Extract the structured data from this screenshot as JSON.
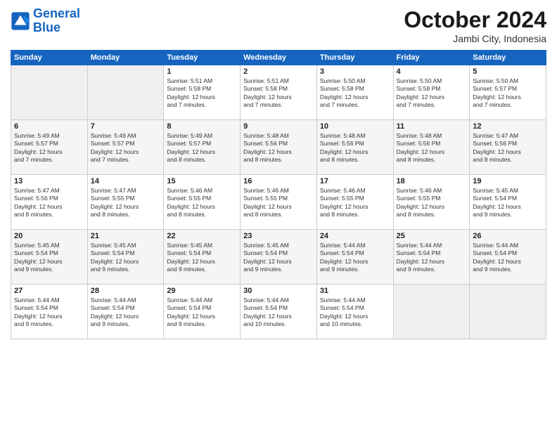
{
  "logo": {
    "line1": "General",
    "line2": "Blue"
  },
  "title": "October 2024",
  "subtitle": "Jambi City, Indonesia",
  "days_of_week": [
    "Sunday",
    "Monday",
    "Tuesday",
    "Wednesday",
    "Thursday",
    "Friday",
    "Saturday"
  ],
  "weeks": [
    [
      {
        "day": null,
        "info": null
      },
      {
        "day": null,
        "info": null
      },
      {
        "day": "1",
        "info": "Sunrise: 5:51 AM\nSunset: 5:58 PM\nDaylight: 12 hours\nand 7 minutes."
      },
      {
        "day": "2",
        "info": "Sunrise: 5:51 AM\nSunset: 5:58 PM\nDaylight: 12 hours\nand 7 minutes."
      },
      {
        "day": "3",
        "info": "Sunrise: 5:50 AM\nSunset: 5:58 PM\nDaylight: 12 hours\nand 7 minutes."
      },
      {
        "day": "4",
        "info": "Sunrise: 5:50 AM\nSunset: 5:58 PM\nDaylight: 12 hours\nand 7 minutes."
      },
      {
        "day": "5",
        "info": "Sunrise: 5:50 AM\nSunset: 5:57 PM\nDaylight: 12 hours\nand 7 minutes."
      }
    ],
    [
      {
        "day": "6",
        "info": "Sunrise: 5:49 AM\nSunset: 5:57 PM\nDaylight: 12 hours\nand 7 minutes."
      },
      {
        "day": "7",
        "info": "Sunrise: 5:49 AM\nSunset: 5:57 PM\nDaylight: 12 hours\nand 7 minutes."
      },
      {
        "day": "8",
        "info": "Sunrise: 5:49 AM\nSunset: 5:57 PM\nDaylight: 12 hours\nand 8 minutes."
      },
      {
        "day": "9",
        "info": "Sunrise: 5:48 AM\nSunset: 5:56 PM\nDaylight: 12 hours\nand 8 minutes."
      },
      {
        "day": "10",
        "info": "Sunrise: 5:48 AM\nSunset: 5:56 PM\nDaylight: 12 hours\nand 8 minutes."
      },
      {
        "day": "11",
        "info": "Sunrise: 5:48 AM\nSunset: 5:56 PM\nDaylight: 12 hours\nand 8 minutes."
      },
      {
        "day": "12",
        "info": "Sunrise: 5:47 AM\nSunset: 5:56 PM\nDaylight: 12 hours\nand 8 minutes."
      }
    ],
    [
      {
        "day": "13",
        "info": "Sunrise: 5:47 AM\nSunset: 5:56 PM\nDaylight: 12 hours\nand 8 minutes."
      },
      {
        "day": "14",
        "info": "Sunrise: 5:47 AM\nSunset: 5:55 PM\nDaylight: 12 hours\nand 8 minutes."
      },
      {
        "day": "15",
        "info": "Sunrise: 5:46 AM\nSunset: 5:55 PM\nDaylight: 12 hours\nand 8 minutes."
      },
      {
        "day": "16",
        "info": "Sunrise: 5:46 AM\nSunset: 5:55 PM\nDaylight: 12 hours\nand 8 minutes."
      },
      {
        "day": "17",
        "info": "Sunrise: 5:46 AM\nSunset: 5:55 PM\nDaylight: 12 hours\nand 8 minutes."
      },
      {
        "day": "18",
        "info": "Sunrise: 5:46 AM\nSunset: 5:55 PM\nDaylight: 12 hours\nand 8 minutes."
      },
      {
        "day": "19",
        "info": "Sunrise: 5:45 AM\nSunset: 5:54 PM\nDaylight: 12 hours\nand 9 minutes."
      }
    ],
    [
      {
        "day": "20",
        "info": "Sunrise: 5:45 AM\nSunset: 5:54 PM\nDaylight: 12 hours\nand 9 minutes."
      },
      {
        "day": "21",
        "info": "Sunrise: 5:45 AM\nSunset: 5:54 PM\nDaylight: 12 hours\nand 9 minutes."
      },
      {
        "day": "22",
        "info": "Sunrise: 5:45 AM\nSunset: 5:54 PM\nDaylight: 12 hours\nand 9 minutes."
      },
      {
        "day": "23",
        "info": "Sunrise: 5:45 AM\nSunset: 5:54 PM\nDaylight: 12 hours\nand 9 minutes."
      },
      {
        "day": "24",
        "info": "Sunrise: 5:44 AM\nSunset: 5:54 PM\nDaylight: 12 hours\nand 9 minutes."
      },
      {
        "day": "25",
        "info": "Sunrise: 5:44 AM\nSunset: 5:54 PM\nDaylight: 12 hours\nand 9 minutes."
      },
      {
        "day": "26",
        "info": "Sunrise: 5:44 AM\nSunset: 5:54 PM\nDaylight: 12 hours\nand 9 minutes."
      }
    ],
    [
      {
        "day": "27",
        "info": "Sunrise: 5:44 AM\nSunset: 5:54 PM\nDaylight: 12 hours\nand 9 minutes."
      },
      {
        "day": "28",
        "info": "Sunrise: 5:44 AM\nSunset: 5:54 PM\nDaylight: 12 hours\nand 9 minutes."
      },
      {
        "day": "29",
        "info": "Sunrise: 5:44 AM\nSunset: 5:54 PM\nDaylight: 12 hours\nand 9 minutes."
      },
      {
        "day": "30",
        "info": "Sunrise: 5:44 AM\nSunset: 5:54 PM\nDaylight: 12 hours\nand 10 minutes."
      },
      {
        "day": "31",
        "info": "Sunrise: 5:44 AM\nSunset: 5:54 PM\nDaylight: 12 hours\nand 10 minutes."
      },
      {
        "day": null,
        "info": null
      },
      {
        "day": null,
        "info": null
      }
    ]
  ]
}
